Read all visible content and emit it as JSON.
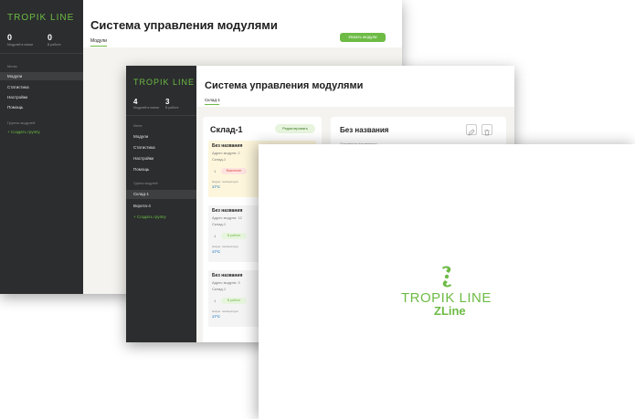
{
  "brand": {
    "logo": "TROPIK LINE",
    "sub": "ZLine",
    "accent": "#6dbb45"
  },
  "w1": {
    "logo": "TROPIK LINE",
    "stats": [
      {
        "value": "0",
        "label": "Модулей в линии"
      },
      {
        "value": "0",
        "label": "В работе"
      }
    ],
    "menu_label": "Меню",
    "menu": [
      "Модули",
      "Статистика",
      "Настройки",
      "Помощь"
    ],
    "groups_label": "Группы модулей",
    "create_group": "+ Создать группу",
    "title": "Система управления модулями",
    "tab": "Модули",
    "add_button": "Искать модули"
  },
  "w2": {
    "logo": "TROPIK LINE",
    "stats": [
      {
        "value": "4",
        "label": "Модулей в линии"
      },
      {
        "value": "3",
        "label": "В работе"
      }
    ],
    "menu_label": "Меню",
    "menu": [
      "Модули",
      "Статистика",
      "Настройки",
      "Помощь"
    ],
    "groups_label": "Группы модулей",
    "groups": [
      "Склад-1",
      "Ворота-4"
    ],
    "create_group": "+ Создать группу",
    "title": "Система управления модулями",
    "tab": "Склад-1",
    "group_card": {
      "title": "Склад-1",
      "edit_button": "Редактировать",
      "modules": [
        {
          "name": "Без названия",
          "addr": "Адрес модуля: 2",
          "group": "Склад-1",
          "num": "1",
          "status": "Выключен",
          "status_color": "#e04b3f",
          "status_bg": "#fde3e0",
          "temp_label": "Наруж. температура",
          "temp": "17°C",
          "bg": "#fdf6dc"
        },
        {
          "name": "Без названия",
          "addr": "Адрес модуля: 12",
          "group": "Склад-1",
          "num": "1",
          "status": "В работе",
          "status_color": "#6dbb45",
          "status_bg": "#e7f4de",
          "temp_label": "Наруж. температура",
          "temp": "17°C",
          "bg": "#f4f4f4"
        },
        {
          "name": "Без названия",
          "addr": "Адрес модуля: 3",
          "group": "Склад-1",
          "num": "1",
          "status": "В работе",
          "status_color": "#6dbb45",
          "status_bg": "#e7f4de",
          "temp_label": "Наруж. температура",
          "temp": "17°C",
          "bg": "#f4f4f4"
        }
      ]
    },
    "detail_card": {
      "title": "Без названия",
      "section": "Основные параметры",
      "icons": [
        "edit-icon",
        "delete-icon"
      ]
    }
  }
}
